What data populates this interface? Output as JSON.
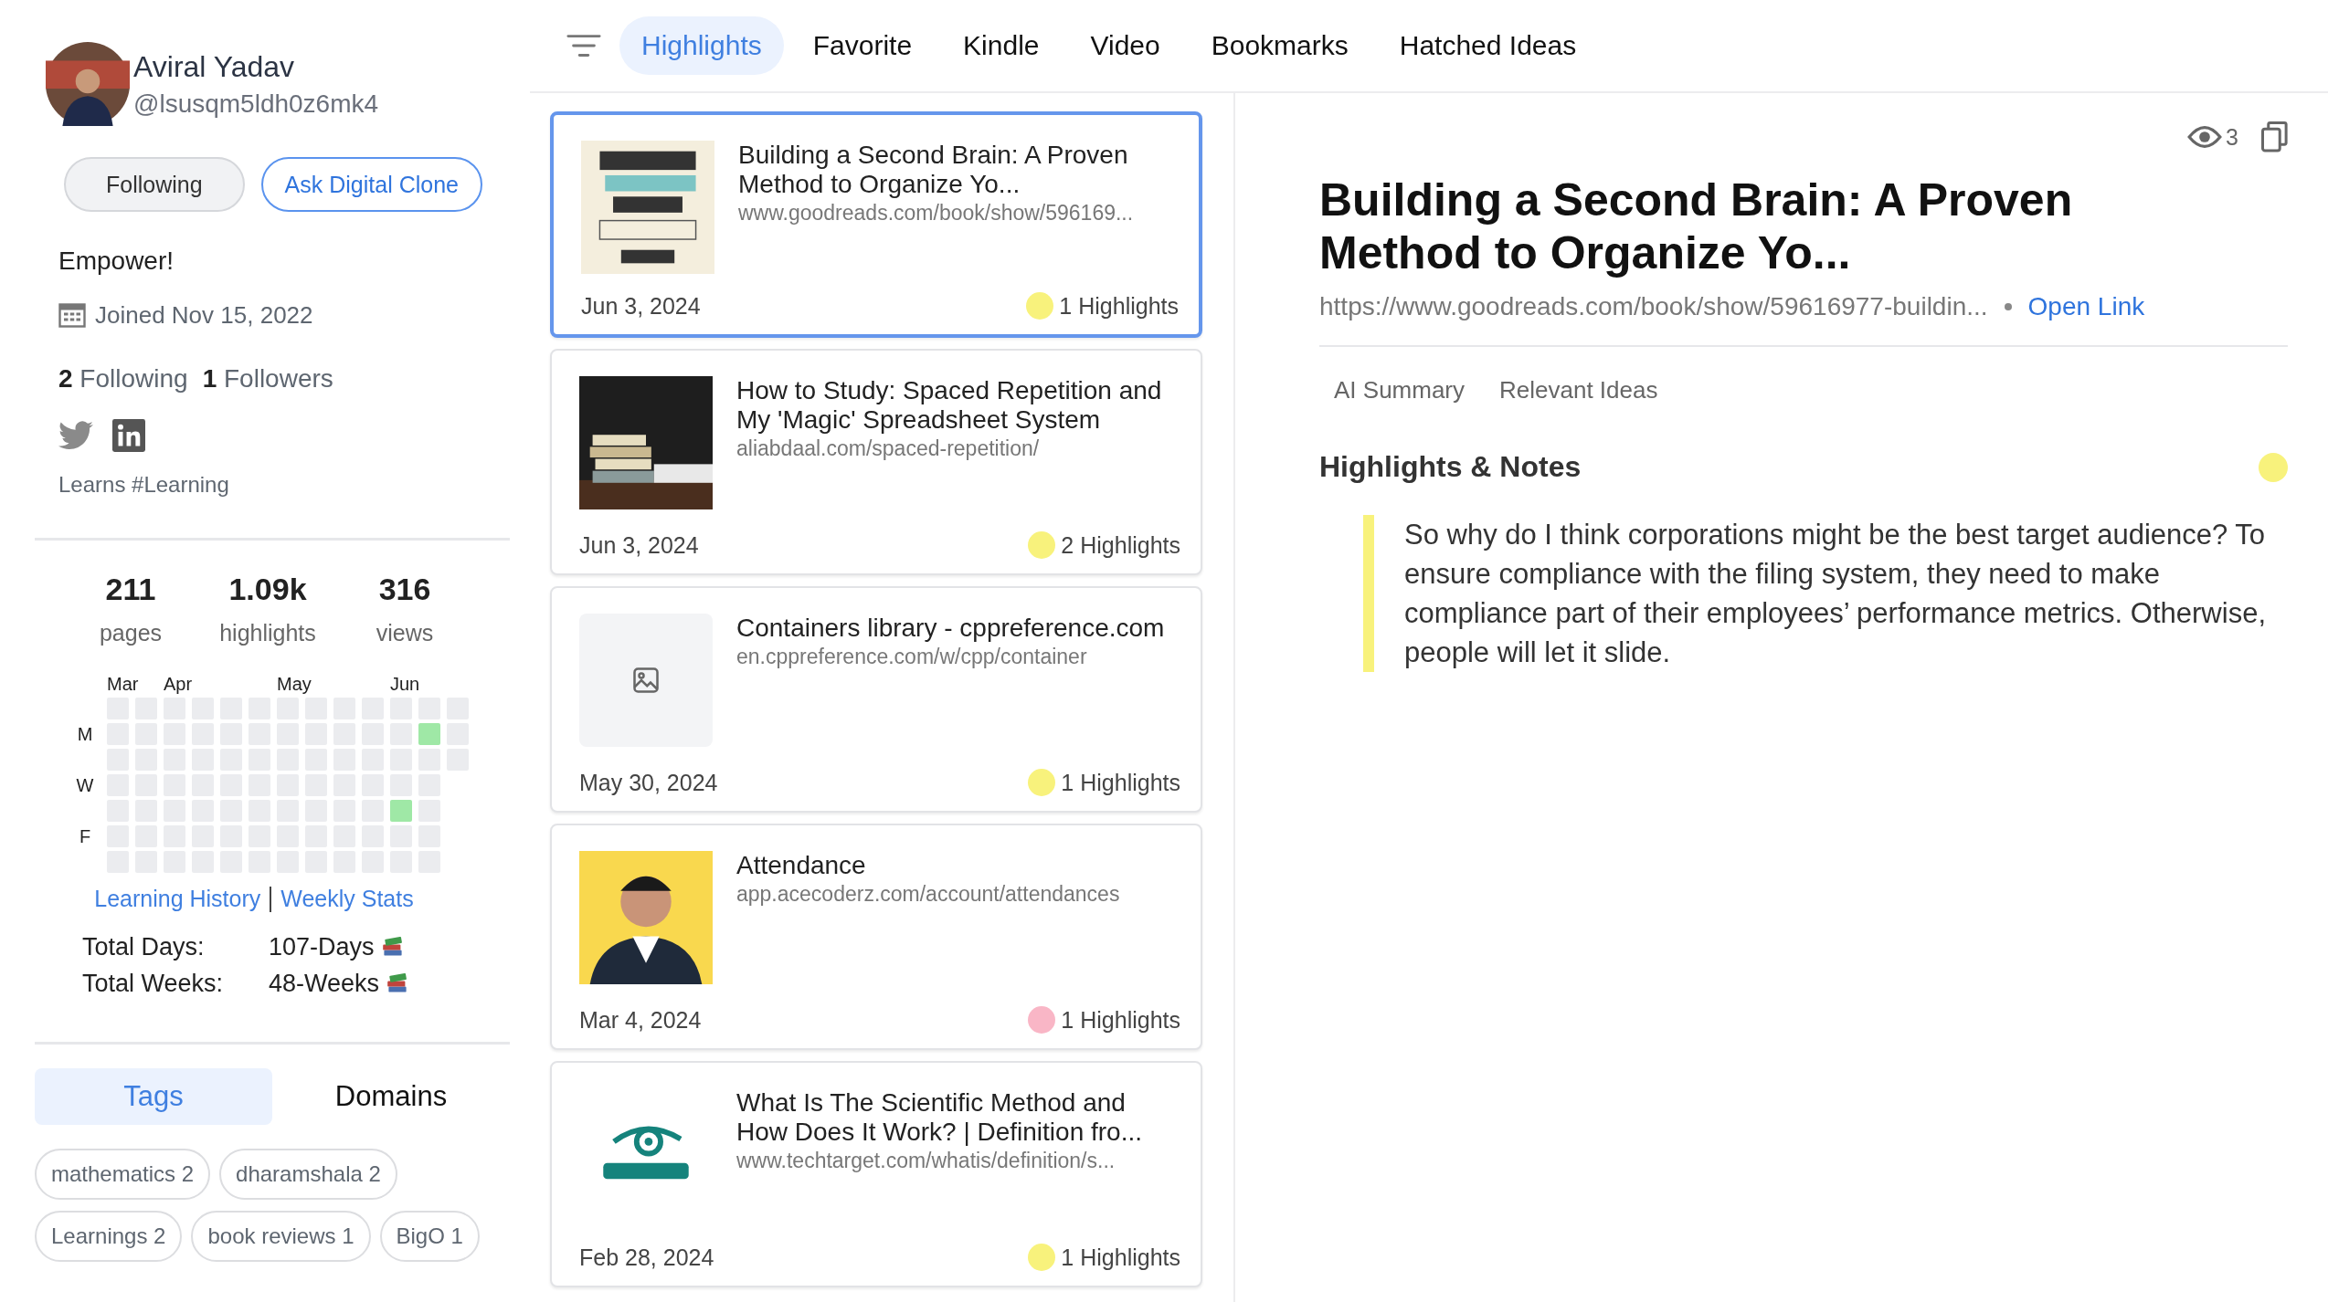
{
  "profile": {
    "name": "Aviral Yadav",
    "handle": "@lsusqm5ldh0z6mk4",
    "buttons": [
      {
        "label": "Following",
        "kind": "secondary"
      },
      {
        "label": "Ask Digital Clone",
        "kind": "outline"
      }
    ],
    "bio": "Empower!",
    "joined": "Joined Nov 15, 2022",
    "following_count": "2",
    "following_label": "Following",
    "followers_count": "1",
    "followers_label": "Followers",
    "social": [
      {
        "kind": "twitter"
      },
      {
        "kind": "linkedin"
      }
    ],
    "learns": "Learns #Learning"
  },
  "stats": [
    {
      "value": "211",
      "label": "pages"
    },
    {
      "value": "1.09k",
      "label": "highlights"
    },
    {
      "value": "316",
      "label": "views"
    }
  ],
  "heatmap": {
    "day_labels": [
      "M",
      "W",
      "F"
    ],
    "weeks": [
      {
        "month": "Mar",
        "days": [
          false,
          false,
          false,
          false,
          false,
          false,
          false
        ]
      },
      {
        "days": [
          false,
          false,
          false,
          false,
          false,
          false,
          false
        ]
      },
      {
        "month": "Apr",
        "days": [
          false,
          false,
          false,
          false,
          false,
          false,
          false
        ]
      },
      {
        "days": [
          false,
          false,
          false,
          false,
          false,
          false,
          false
        ]
      },
      {
        "days": [
          false,
          false,
          false,
          false,
          false,
          false,
          false
        ]
      },
      {
        "days": [
          false,
          false,
          false,
          false,
          false,
          false,
          false
        ]
      },
      {
        "month": "May",
        "days": [
          false,
          false,
          false,
          false,
          false,
          false,
          false
        ]
      },
      {
        "days": [
          false,
          false,
          false,
          false,
          false,
          false,
          false
        ]
      },
      {
        "days": [
          false,
          false,
          false,
          false,
          false,
          false,
          false
        ]
      },
      {
        "days": [
          false,
          false,
          false,
          false,
          false,
          false,
          false
        ]
      },
      {
        "month": "Jun",
        "days": [
          false,
          false,
          false,
          false,
          true,
          false,
          false
        ]
      },
      {
        "days": [
          false,
          true,
          false,
          false,
          false,
          false,
          false
        ]
      },
      {
        "days": [
          false,
          false,
          false
        ]
      }
    ]
  },
  "links": [
    "Learning History",
    "Weekly Stats"
  ],
  "totals": [
    {
      "label": "Total Days:",
      "value": "107-Days"
    },
    {
      "label": "Total Weeks:",
      "value": "48-Weeks"
    }
  ],
  "side_tabs": [
    {
      "label": "Tags",
      "selected": true
    },
    {
      "label": "Domains",
      "selected": false
    }
  ],
  "tags": [
    "mathematics 2",
    "dharamshala 2",
    "Learnings 2",
    "book reviews 1",
    "BigO 1"
  ],
  "filter_tabs": [
    {
      "label": "Highlights",
      "selected": true
    },
    {
      "label": "Favorite",
      "selected": false
    },
    {
      "label": "Kindle",
      "selected": false
    },
    {
      "label": "Video",
      "selected": false
    },
    {
      "label": "Bookmarks",
      "selected": false
    },
    {
      "label": "Hatched Ideas",
      "selected": false
    }
  ],
  "cards": [
    {
      "title": "Building a Second Brain: A Proven Method to Organize Yo...",
      "url": "www.goodreads.com/book/show/596169...",
      "date": "Jun 3, 2024",
      "count": "1 Highlights",
      "color": "#f8f27c",
      "selected": true,
      "kind": "picture"
    },
    {
      "title": "How to Study: Spaced Repetition and My 'Magic' Spreadsheet System",
      "url": "aliabdaal.com/spaced-repetition/",
      "date": "Jun 3, 2024",
      "count": "2 Highlights",
      "color": "#f8f27c",
      "selected": false,
      "kind": "picture"
    },
    {
      "title": "Containers library - cppreference.com",
      "url": "en.cppreference.com/w/cpp/container",
      "date": "May 30, 2024",
      "count": "1 Highlights",
      "color": "#f8f27c",
      "selected": false,
      "kind": "placeholder"
    },
    {
      "title": "Attendance",
      "url": "app.acecoderz.com/account/attendances",
      "date": "Mar 4, 2024",
      "count": "1 Highlights",
      "color": "#f9b6c6",
      "selected": false,
      "kind": "picture"
    },
    {
      "title": "What Is The Scientific Method and How Does It Work? | Definition fro...",
      "url": "www.techtarget.com/whatis/definition/s...",
      "date": "Feb 28, 2024",
      "count": "1 Highlights",
      "color": "#f8f27c",
      "selected": false,
      "kind": "picture"
    }
  ],
  "detail": {
    "views": "3",
    "title": "Building a Second Brain: A Proven Method to Organize Yo...",
    "url": "https://www.goodreads.com/book/show/59616977-buildin...",
    "open_link": "Open Link",
    "tabs": [
      {
        "label": "AI Summary",
        "selected": false
      },
      {
        "label": "Relevant Ideas",
        "selected": false
      }
    ],
    "section": {
      "title": "Highlights & Notes",
      "color": "#f8f27c"
    },
    "highlights": [
      {
        "text": "So why do I think corporations might be the best target audience? To ensure compliance with the filing system, they need to make compliance part of their employees’ performance metrics. Otherwise, people will let it slide.",
        "color": "#f8f27c"
      }
    ]
  }
}
